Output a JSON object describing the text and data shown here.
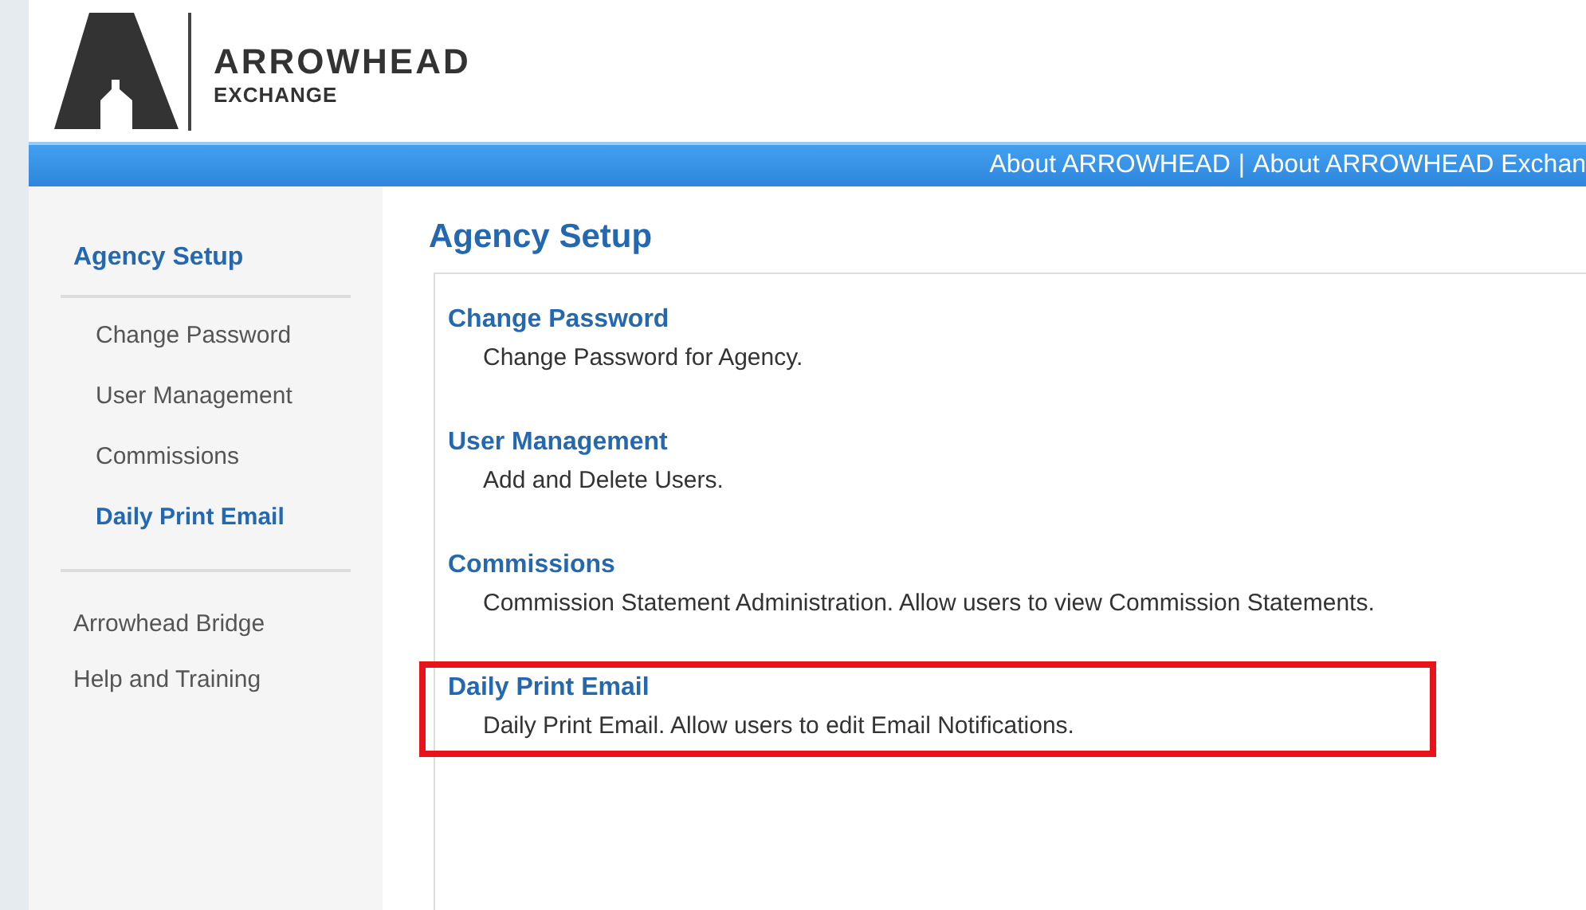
{
  "logo": {
    "name": "ARROWHEAD",
    "tagline": "EXCHANGE"
  },
  "top_bar": {
    "links": [
      "About ARROWHEAD",
      "About ARROWHEAD Exchan"
    ],
    "separator": "|"
  },
  "sidebar": {
    "items": [
      {
        "label": "Agency Setup",
        "kind": "heading",
        "children": [
          {
            "label": "Change Password",
            "selected": false
          },
          {
            "label": "User Management",
            "selected": false
          },
          {
            "label": "Commissions",
            "selected": false
          },
          {
            "label": "Daily Print Email",
            "selected": true
          }
        ]
      },
      {
        "label": "Arrowhead Bridge",
        "kind": "link"
      },
      {
        "label": "Help and Training",
        "kind": "link"
      }
    ]
  },
  "main": {
    "title": "Agency Setup",
    "items": [
      {
        "title": "Change Password",
        "description": "Change Password for Agency.",
        "highlighted": false
      },
      {
        "title": "User Management",
        "description": "Add and Delete Users.",
        "highlighted": false
      },
      {
        "title": "Commissions",
        "description": "Commission Statement Administration. Allow users to view Commission Statements.",
        "highlighted": false
      },
      {
        "title": "Daily Print Email",
        "description": "Daily Print Email. Allow users to edit Email Notifications.",
        "highlighted": true
      }
    ]
  }
}
